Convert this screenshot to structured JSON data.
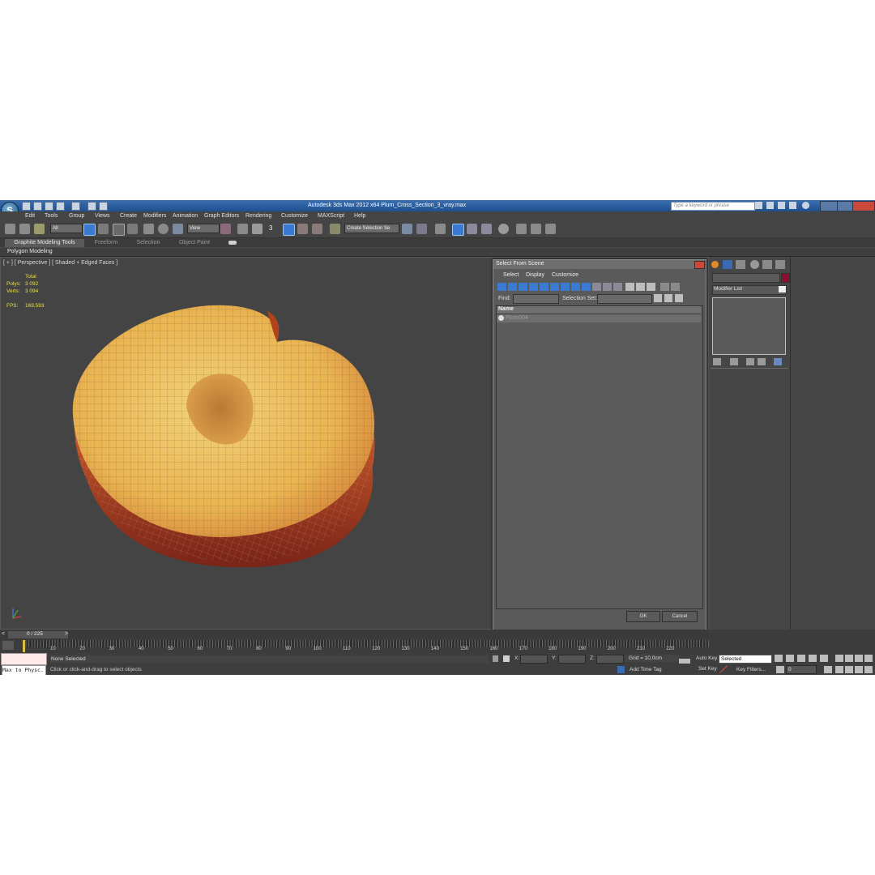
{
  "window": {
    "app_icon": "3ds-max-logo",
    "logo_letter": "S",
    "title": "Autodesk 3ds Max  2012 x64    Plum_Cross_Section_3_vray.max",
    "search_placeholder": "Type a keyword or phrase"
  },
  "menu": [
    "Edit",
    "Tools",
    "Group",
    "Views",
    "Create",
    "Modifiers",
    "Animation",
    "Graph Editors",
    "Rendering",
    "Customize",
    "MAXScript",
    "Help"
  ],
  "toolbar": {
    "filter_value": "All",
    "coord_value": "View",
    "snap_label": "3",
    "selection_set_value": "Create Selection Se"
  },
  "ribbon": {
    "tabs": [
      "Graphite Modeling Tools",
      "Freeform",
      "Selection",
      "Object Paint"
    ],
    "sub_label": "Polygon Modeling"
  },
  "viewport": {
    "label": "[ + ] [ Perspective ] [ Shaded + Edged Faces ]",
    "stats": {
      "header": "Total",
      "polys_label": "Polys:",
      "polys_value": "3 092",
      "verts_label": "Verts:",
      "verts_value": "3 094",
      "fps_label": "FPS:",
      "fps_value": "169,593"
    }
  },
  "dialog": {
    "title": "Select From Scene",
    "menu": [
      "Select",
      "Display",
      "Customize"
    ],
    "find_label": "Find:",
    "selection_set_label": "Selection Set:",
    "column_header": "Name",
    "items": [
      "Plum004"
    ],
    "ok_label": "OK",
    "cancel_label": "Cancel"
  },
  "command_panel": {
    "modifier_list_label": "Modifier List",
    "color_swatch": "#8a1030"
  },
  "timeline": {
    "frame_counter": "0 / 225",
    "ticks": [
      "10",
      "20",
      "30",
      "40",
      "50",
      "60",
      "70",
      "80",
      "90",
      "100",
      "110",
      "120",
      "130",
      "140",
      "150",
      "160",
      "170",
      "180",
      "190",
      "200",
      "210",
      "220"
    ]
  },
  "status": {
    "maxscript_listener": "Max to Physc.",
    "selection_status": "None Selected",
    "prompt": "Click or click-and-drag to select objects",
    "x_label": "X:",
    "y_label": "Y:",
    "z_label": "Z:",
    "grid": "Grid = 10,0cm",
    "add_time_tag": "Add Time Tag",
    "auto_key": "Auto Key",
    "set_key": "Set Key",
    "selected_value": "Selected",
    "key_filters": "Key Filters...",
    "frame_value": "0"
  }
}
